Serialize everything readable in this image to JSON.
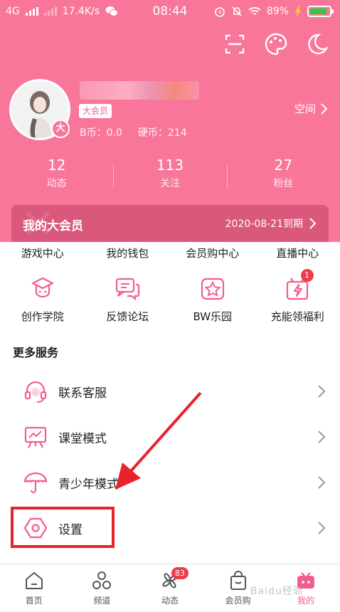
{
  "status_bar": {
    "network": "4G",
    "speed": "17.4K/s",
    "time": "08:44",
    "battery": "89%",
    "battery_level": 0.89
  },
  "top_icons": [
    "scan-icon",
    "palette-icon",
    "night-mode-icon"
  ],
  "profile": {
    "vip_tag": "大会员",
    "avatar_badge": "大",
    "b_coin": "B币：0.0",
    "hard_coin": "硬币：214",
    "space_label": "空间"
  },
  "stats": [
    {
      "value": "12",
      "label": "动态"
    },
    {
      "value": "113",
      "label": "关注"
    },
    {
      "value": "27",
      "label": "粉丝"
    }
  ],
  "vip_banner": {
    "title": "我的大会员",
    "expire": "2020-08-21到期"
  },
  "quick_links": [
    "游戏中心",
    "我的钱包",
    "会员购中心",
    "直播中心"
  ],
  "grid": [
    {
      "label": "创作学院",
      "icon": "graduation-cap-icon"
    },
    {
      "label": "反馈论坛",
      "icon": "chat-bubbles-icon"
    },
    {
      "label": "BW乐园",
      "icon": "star-icon"
    },
    {
      "label": "充能领福利",
      "icon": "gift-bolt-icon",
      "badge": "1"
    }
  ],
  "more_services": {
    "title": "更多服务",
    "items": [
      {
        "label": "联系客服",
        "icon": "headset-icon"
      },
      {
        "label": "课堂模式",
        "icon": "classroom-icon"
      },
      {
        "label": "青少年模式",
        "icon": "umbrella-icon"
      },
      {
        "label": "设置",
        "icon": "settings-icon"
      }
    ]
  },
  "bottom_nav": [
    {
      "label": "首页",
      "icon": "home-icon"
    },
    {
      "label": "频道",
      "icon": "channels-icon"
    },
    {
      "label": "动态",
      "icon": "pinwheel-icon",
      "badge": "83"
    },
    {
      "label": "会员购",
      "icon": "shopping-bag-icon"
    },
    {
      "label": "我的",
      "icon": "tv-face-icon",
      "active": true
    }
  ],
  "watermark": "Baidu经验",
  "colors": {
    "brand_pink": "#f87699",
    "accent_pink": "#f25d8e",
    "banner": "#d9587c",
    "annotation_red": "#e8232c"
  }
}
